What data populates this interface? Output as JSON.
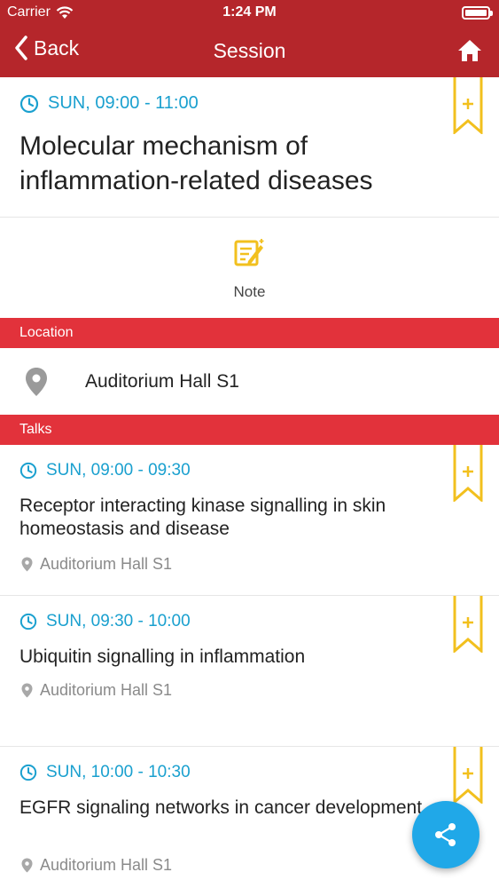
{
  "status_bar": {
    "carrier": "Carrier",
    "time": "1:24 PM"
  },
  "nav": {
    "back_label": "Back",
    "title": "Session"
  },
  "session": {
    "time": "SUN, 09:00 - 11:00",
    "title": "Molecular mechanism of inflammation-related diseases"
  },
  "note": {
    "label": "Note"
  },
  "location_section": {
    "header": "Location",
    "name": "Auditorium Hall S1"
  },
  "talks_section": {
    "header": "Talks",
    "items": [
      {
        "time": "SUN, 09:00 - 09:30",
        "title": "Receptor interacting kinase signalling in skin homeostasis and disease",
        "location": "Auditorium Hall S1"
      },
      {
        "time": "SUN, 09:30 - 10:00",
        "title": "Ubiquitin signalling in inflammation",
        "location": "Auditorium Hall S1"
      },
      {
        "time": "SUN, 10:00 - 10:30",
        "title": "EGFR signaling networks in cancer development",
        "location": "Auditorium Hall S1"
      }
    ]
  },
  "colors": {
    "nav_bar": "#b5262b",
    "section_header": "#e2323b",
    "time_text": "#1aa0cf",
    "bookmark": "#f2c01e",
    "fab": "#20a8e8",
    "note_icon": "#f2c01e"
  }
}
